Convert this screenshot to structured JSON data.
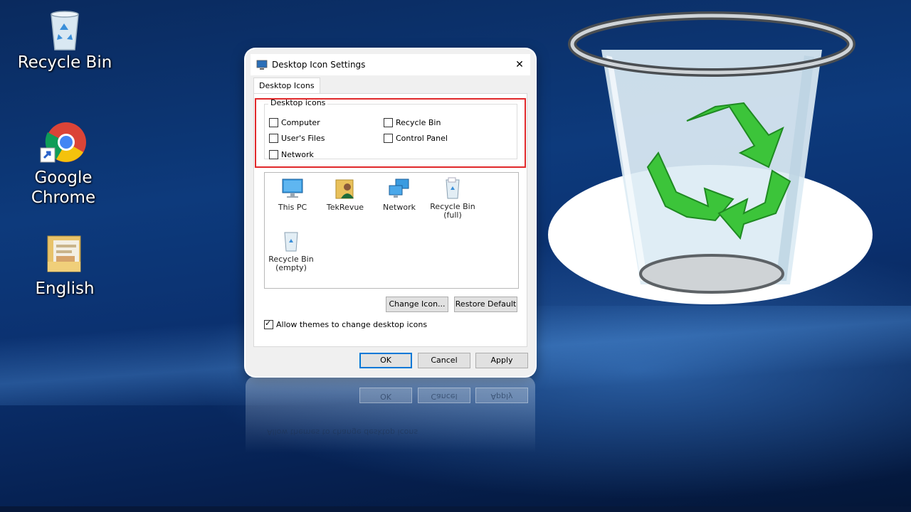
{
  "desktop": {
    "icons": [
      {
        "label": "Recycle Bin",
        "icon": "recycle-bin-icon"
      },
      {
        "label": "Google Chrome",
        "icon": "chrome-icon"
      },
      {
        "label": "English",
        "icon": "folder-icon"
      }
    ]
  },
  "dialog": {
    "title": "Desktop Icon Settings",
    "close_glyph": "✕",
    "tab_label": "Desktop Icons",
    "group_title": "Desktop icons",
    "checkboxes": [
      {
        "label": "Computer",
        "checked": false
      },
      {
        "label": "Recycle Bin",
        "checked": false
      },
      {
        "label": "User's Files",
        "checked": false
      },
      {
        "label": "Control Panel",
        "checked": false
      },
      {
        "label": "Network",
        "checked": false
      }
    ],
    "icon_list": [
      {
        "label": "This PC",
        "icon": "monitor-icon"
      },
      {
        "label": "TekRevue",
        "icon": "user-folder-icon"
      },
      {
        "label": "Network",
        "icon": "network-icon"
      },
      {
        "label": "Recycle Bin\n(full)",
        "icon": "recycle-bin-full-icon"
      },
      {
        "label": "Recycle Bin\n(empty)",
        "icon": "recycle-bin-empty-icon"
      }
    ],
    "change_icon_label": "Change Icon...",
    "restore_default_label": "Restore Default",
    "allow_themes": {
      "label": "Allow themes to change desktop icons",
      "checked": true
    },
    "ok_label": "OK",
    "cancel_label": "Cancel",
    "apply_label": "Apply"
  },
  "colors": {
    "highlight_box": "#e0282a",
    "default_button_border": "#0078d7",
    "recycle_green": "#3cc43a"
  }
}
